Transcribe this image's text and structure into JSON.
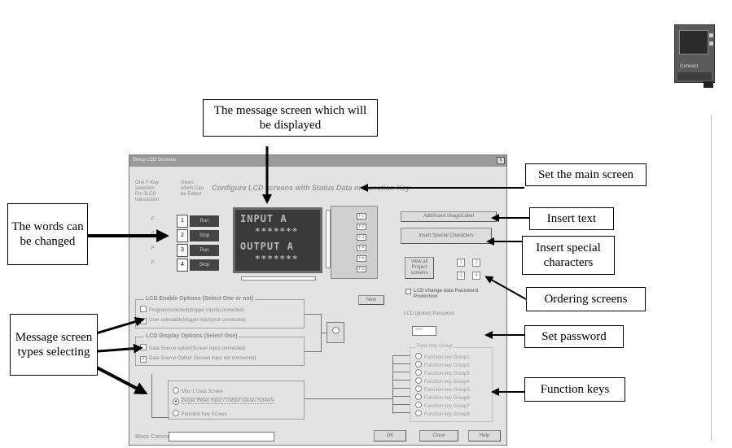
{
  "callouts": {
    "message_screen": "The message screen which will be displayed",
    "main_screen": "Set the main screen",
    "words_changed": "The words can be changed",
    "insert_text": "Insert text",
    "insert_special": "Insert special characters",
    "ordering_screens": "Ordering screens",
    "message_types": "Message screen types selecting",
    "set_password": "Set password",
    "function_keys": "Function keys"
  },
  "dialog": {
    "title": "Setup LCD Screens",
    "close_glyph": "x",
    "heading": "Configure LCD screens with Status Data or Function Key",
    "note_col1": "One F-Key selection Pin 3LCD transaction",
    "note_col2": "Given which Can be Edited",
    "word_rows": [
      {
        "check": "F",
        "index": "1",
        "label": "Run"
      },
      {
        "check": "F",
        "index": "2",
        "label": "Stop"
      },
      {
        "check": "F",
        "index": "3",
        "label": "Run"
      },
      {
        "check": "F",
        "index": "4",
        "label": "Stop"
      }
    ],
    "lcd_line1": "INPUT A",
    "lcd_line2": "*******",
    "lcd_line3": "OUTPUT A",
    "lcd_line4": "*******",
    "lcd_side_keys": [
      "F1",
      "F2",
      "F3",
      "F4",
      "F5",
      "F6"
    ],
    "btn_insert_text": "Add/Insert Image/Label",
    "btn_insert_special": "Insert Special Characters",
    "btn_view_all": "View all Project screens",
    "order_numbers": [
      "1",
      "2",
      "3",
      "4"
    ],
    "btn_new": "New",
    "lcd_change_check": "LCD change data Password Protection",
    "password_label": "LCD (global) Password",
    "password_value": "****",
    "enable_group_title": "LCD Enable Options (Select One or not)",
    "enable_opts": [
      "Program(selected)(trigger input)(connected)",
      "User selectable(trigger input)(not connected)"
    ],
    "display_group_title": "LCD Display Options (Select One)",
    "display_opts": [
      "Data Source option(Screen input connected)",
      "Data Source Option (Screen input not connected)"
    ],
    "screen_types": [
      "Max 1 Data Screen",
      "Super Relay Input / Output values Screen",
      "Function Key Screen"
    ],
    "fk_group_title": "Func Key Group",
    "fk_rows": [
      "Function key Group1",
      "Function key Group2",
      "Function key Group3",
      "Function key Group4",
      "Function key Group5",
      "Function key Group6",
      "Function key Group7",
      "Function key Group8"
    ],
    "block_comment_label": "Block Comment",
    "block_comment_value": "",
    "btn_ok": "OK",
    "btn_close": "Close",
    "btn_help": "Help"
  },
  "thumbnail": {
    "caption": "Connect"
  },
  "colors": {
    "page_bg": "#ffffff",
    "dialog_bg": "#e3e3e3",
    "lcd_bg": "#3a3a3a"
  }
}
